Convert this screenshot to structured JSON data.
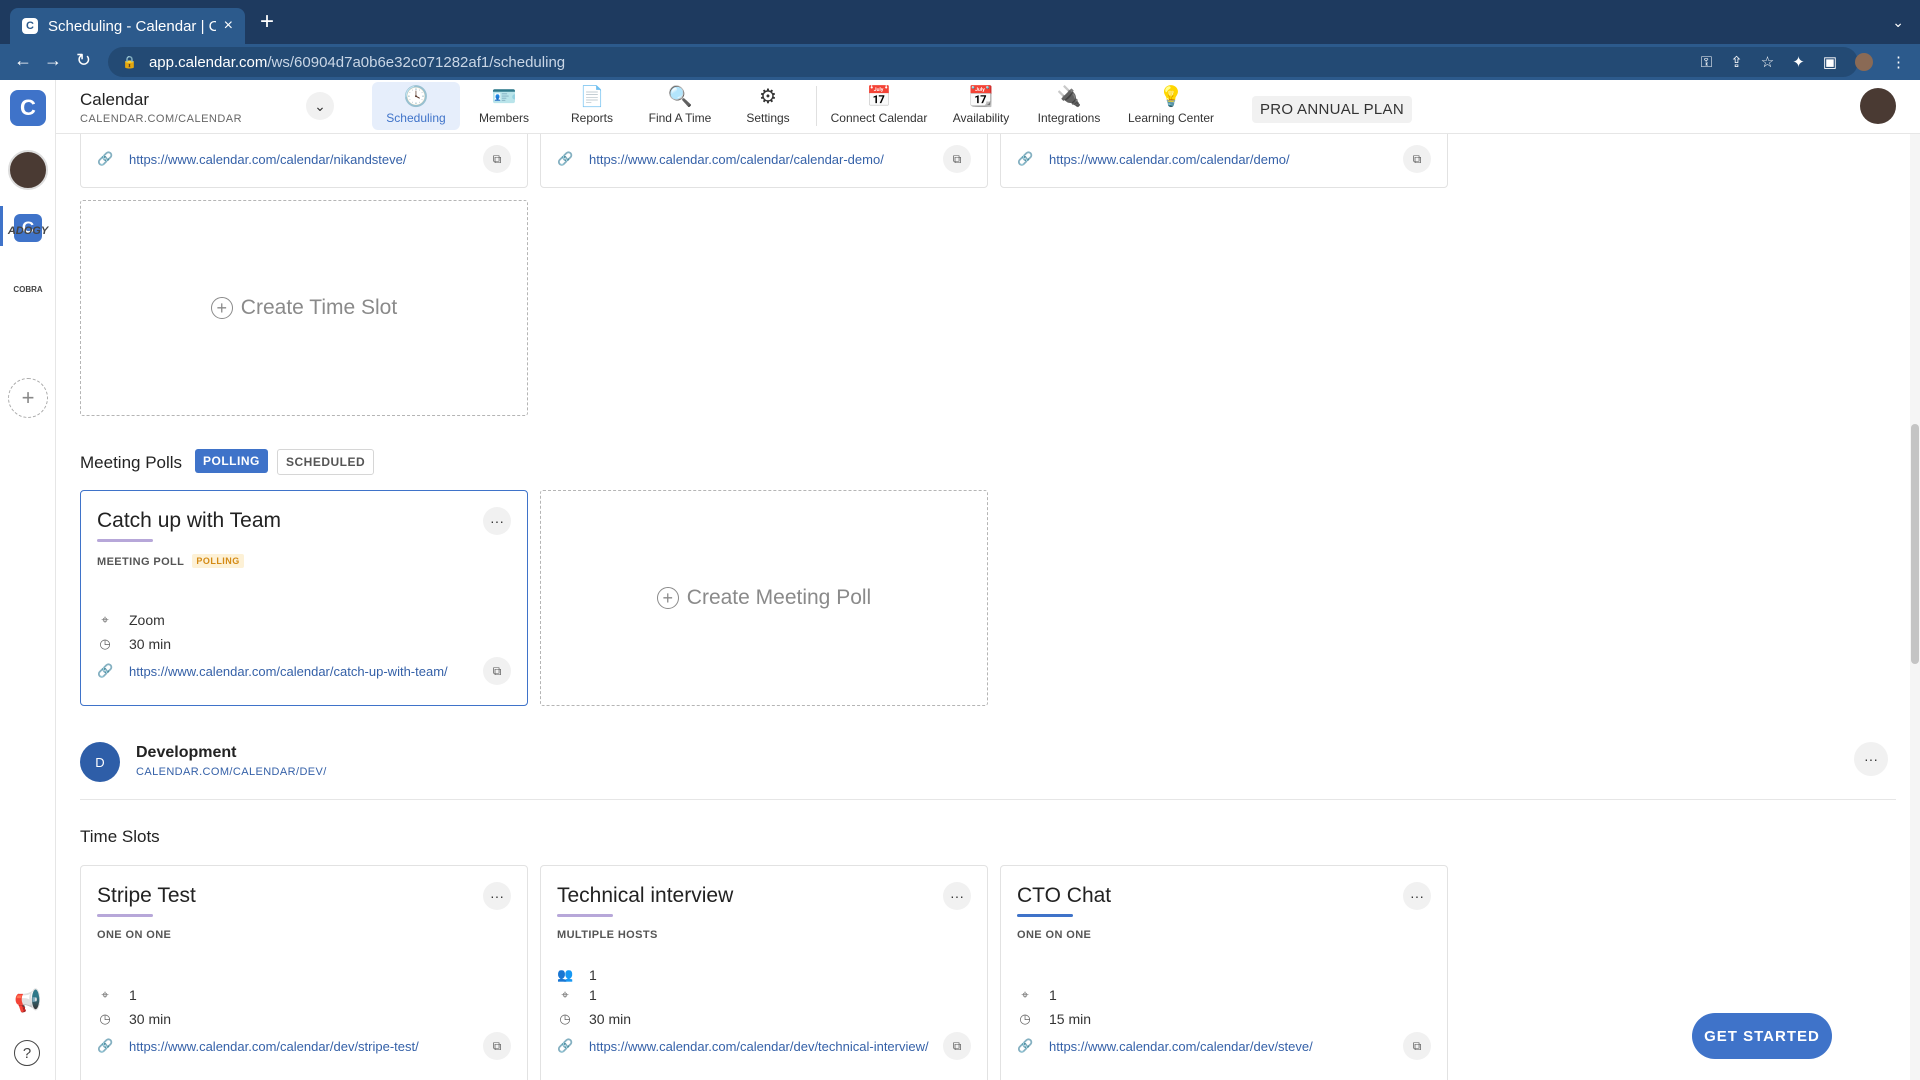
{
  "browser": {
    "tab_title": "Scheduling - Calendar | Calendar",
    "tab_favicon": "C",
    "url_host": "app.calendar.com",
    "url_path": "/ws/60904d7a0b6e32c071282af1/scheduling"
  },
  "rail": {
    "logo": "C",
    "workspace_c": "C",
    "adogy": "ADOGY",
    "cobra": "COBRA",
    "add": "+"
  },
  "header": {
    "workspace_name": "Calendar",
    "workspace_url": "CALENDAR.COM/CALENDAR",
    "nav": {
      "scheduling": "Scheduling",
      "members": "Members",
      "reports": "Reports",
      "find_a_time": "Find A Time",
      "settings": "Settings",
      "connect_calendar": "Connect Calendar",
      "availability": "Availability",
      "integrations": "Integrations",
      "learning_center": "Learning Center"
    },
    "plan": "PRO ANNUAL PLAN"
  },
  "top_links": {
    "link1": "https://www.calendar.com/calendar/nikandsteve/",
    "link2": "https://www.calendar.com/calendar/calendar-demo/",
    "link3": "https://www.calendar.com/calendar/demo/"
  },
  "create_time_slot": "Create Time Slot",
  "meeting_polls": {
    "title": "Meeting Polls",
    "filter_polling": "POLLING",
    "filter_scheduled": "SCHEDULED",
    "card": {
      "title": "Catch up with Team",
      "type": "MEETING POLL",
      "badge": "POLLING",
      "location": "Zoom",
      "duration": "30 min",
      "link": "https://www.calendar.com/calendar/catch-up-with-team/"
    },
    "create": "Create Meeting Poll"
  },
  "group": {
    "avatar": "D",
    "name": "Development",
    "url": "CALENDAR.COM/CALENDAR/DEV/"
  },
  "time_slots": {
    "title": "Time Slots",
    "cards": [
      {
        "title": "Stripe Test",
        "type": "ONE ON ONE",
        "location": "1",
        "duration": "30 min",
        "link": "https://www.calendar.com/calendar/dev/stripe-test/"
      },
      {
        "title": "Technical interview",
        "type": "MULTIPLE HOSTS",
        "hosts": "1",
        "location": "1",
        "duration": "30 min",
        "link": "https://www.calendar.com/calendar/dev/technical-interview/"
      },
      {
        "title": "CTO Chat",
        "type": "ONE ON ONE",
        "location": "1",
        "duration": "15 min",
        "link": "https://www.calendar.com/calendar/dev/steve/"
      }
    ]
  },
  "get_started": "GET STARTED",
  "colors": {
    "brand": "#3f73c9",
    "chrome": "#2c5a8c",
    "badge_bg": "#fdf1d6",
    "badge_text": "#d48a14"
  }
}
